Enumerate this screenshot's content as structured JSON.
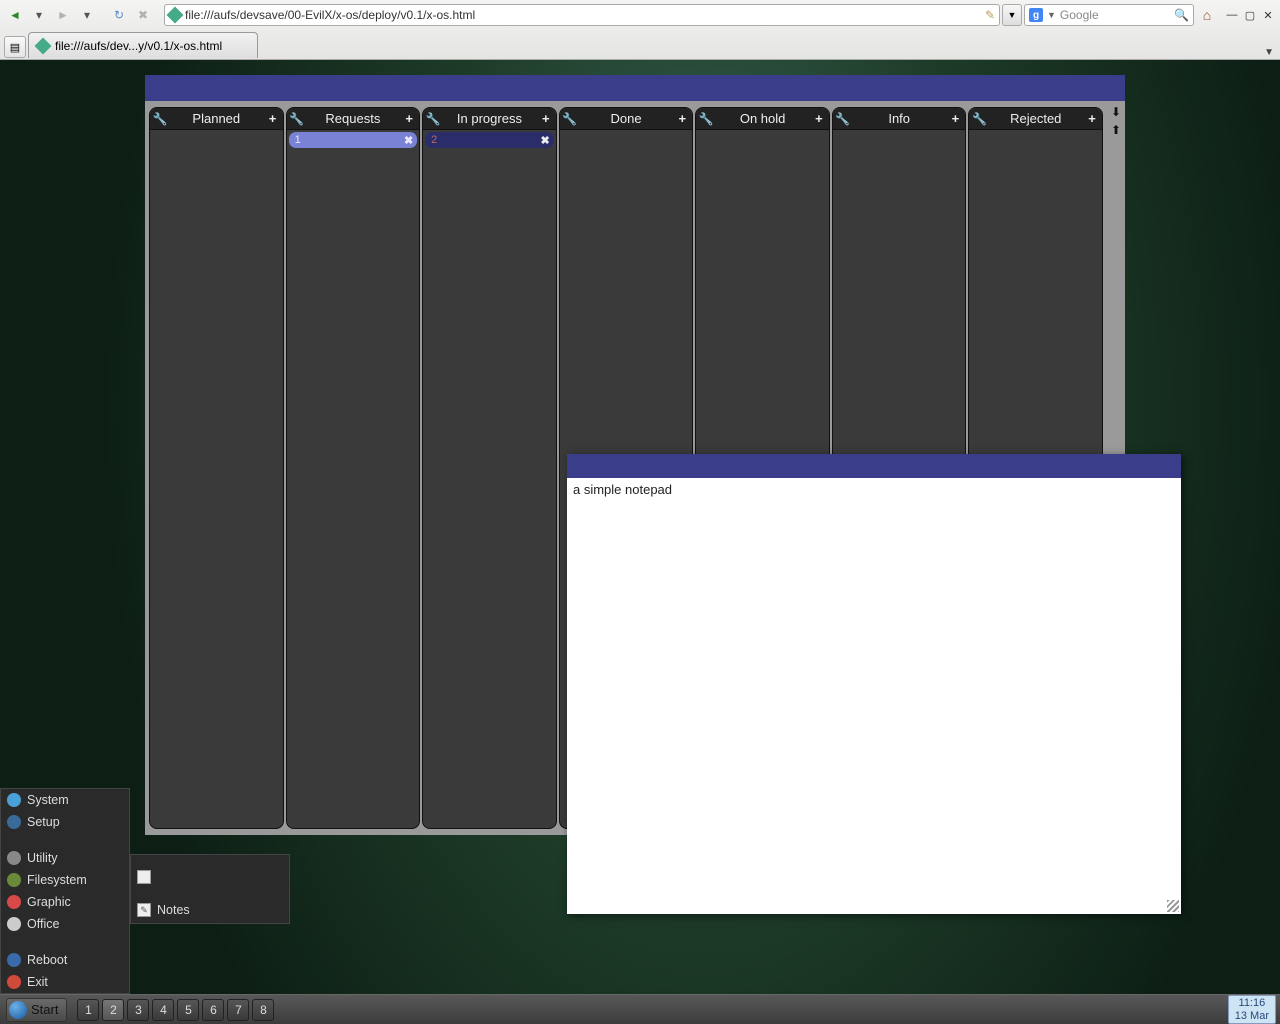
{
  "browser": {
    "url": "file:///aufs/devsave/00-EvilX/x-os/deploy/v0.1/x-os.html",
    "tab_title": "file:///aufs/dev...y/v0.1/x-os.html",
    "search_placeholder": "Google"
  },
  "kanban": {
    "columns": [
      {
        "title": "Planned",
        "cards": []
      },
      {
        "title": "Requests",
        "cards": [
          {
            "label": "1",
            "style": "card1"
          }
        ]
      },
      {
        "title": "In progress",
        "cards": [
          {
            "label": "2",
            "style": "card2"
          }
        ]
      },
      {
        "title": "Done",
        "cards": []
      },
      {
        "title": "On hold",
        "cards": []
      },
      {
        "title": "Info",
        "cards": []
      },
      {
        "title": "Rejected",
        "cards": []
      }
    ]
  },
  "notepad": {
    "text": "a simple notepad"
  },
  "start_menu": {
    "items": [
      "System",
      "Setup",
      "Utility",
      "Filesystem",
      "Graphic",
      "Office",
      "Reboot",
      "Exit"
    ],
    "submenu_visible_item": "Notes"
  },
  "taskbar": {
    "start_label": "Start",
    "workspaces": [
      "1",
      "2",
      "3",
      "4",
      "5",
      "6",
      "7",
      "8"
    ],
    "active_ws": "2",
    "clock_time": "11:16",
    "clock_date": "13 Mar"
  }
}
